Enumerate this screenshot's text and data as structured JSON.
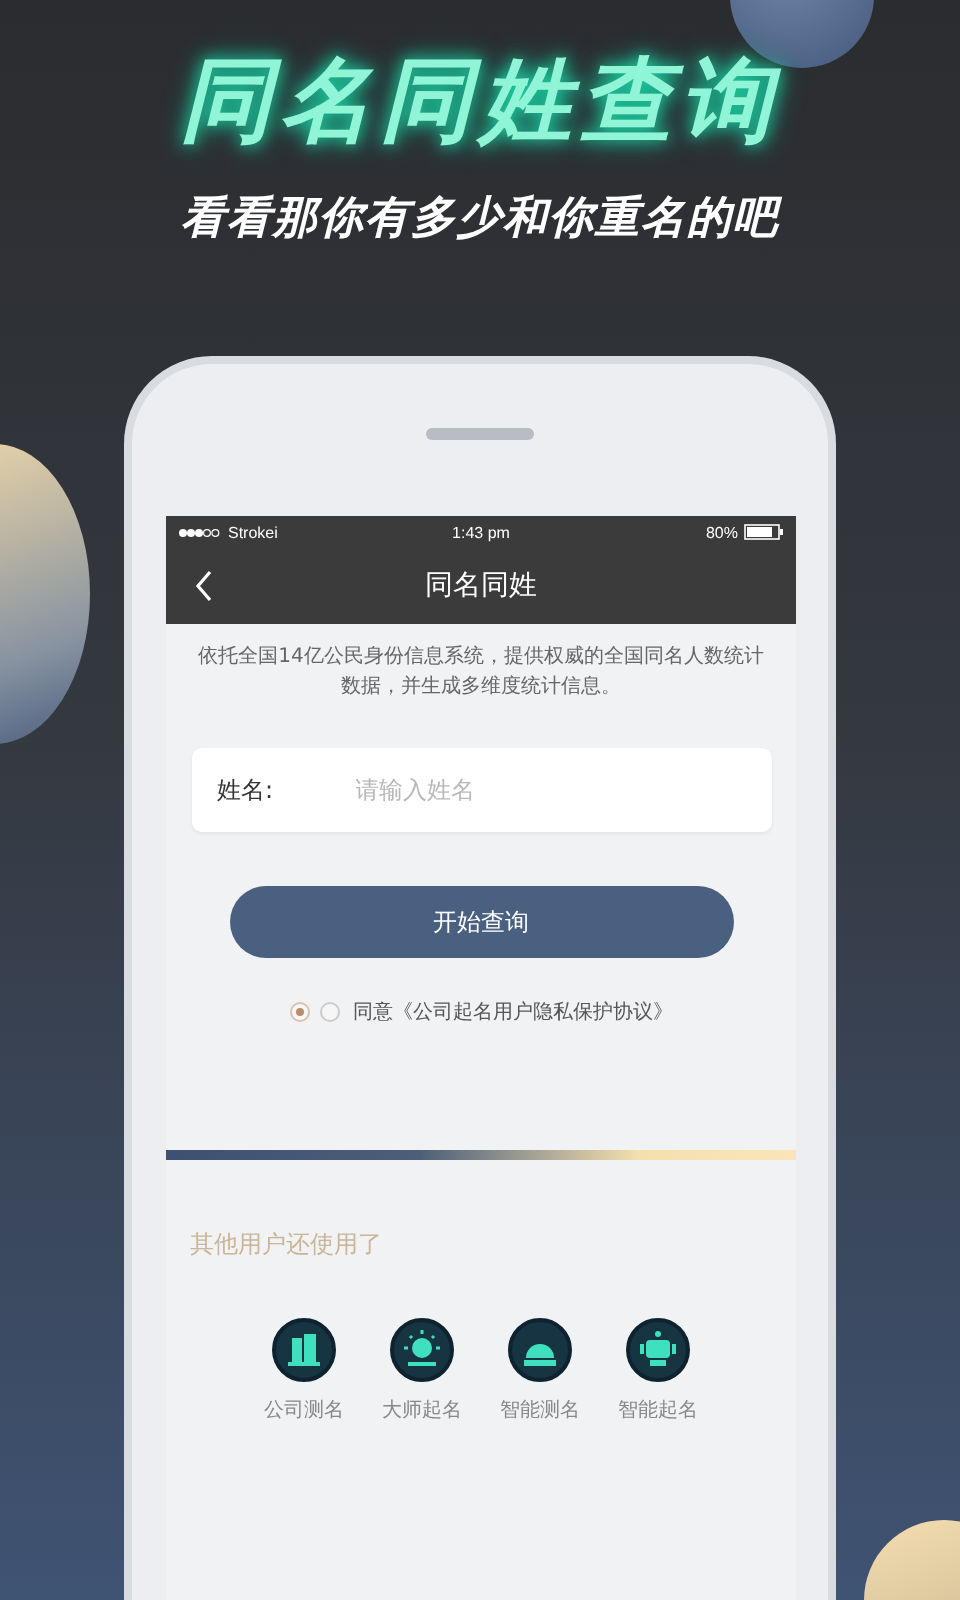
{
  "headline": {
    "title": "同名同姓查询",
    "subtitle": "看看那你有多少和你重名的吧"
  },
  "status_bar": {
    "carrier": "Strokei",
    "time": "1:43 pm",
    "battery": "80%"
  },
  "nav_bar": {
    "title": "同名同姓"
  },
  "description": "依托全国14亿公民身份信息系统，提供权威的全国同名人数统计数据，并生成多维度统计信息。",
  "name_field": {
    "label": "姓名:",
    "placeholder": "请输入姓名"
  },
  "search_button": "开始查询",
  "agreement": {
    "radios": [
      {
        "selected": true
      },
      {
        "selected": false
      }
    ],
    "text": "同意《公司起名用户隐私保护协议》"
  },
  "more_section": {
    "title": "其他用户还使用了",
    "items": [
      {
        "kind": "building",
        "label": "公司测名"
      },
      {
        "kind": "sun",
        "label": "大师起名"
      },
      {
        "kind": "dome",
        "label": "智能测名"
      },
      {
        "kind": "robot",
        "label": "智能起名"
      }
    ]
  }
}
